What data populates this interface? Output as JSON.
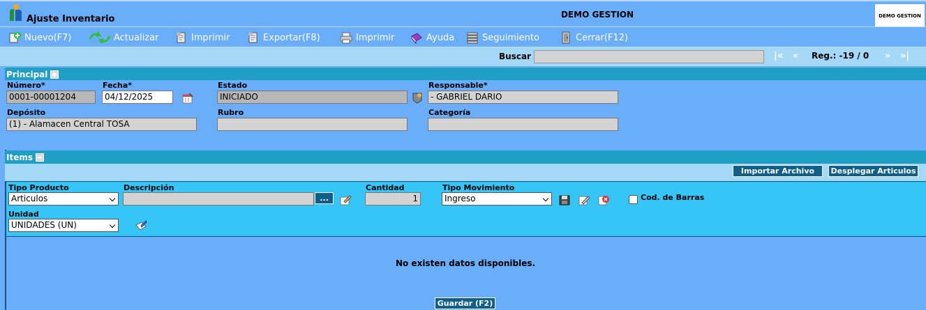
{
  "window": {
    "title": "Ajuste Inventario",
    "company": "DEMO GESTION",
    "logo_text": "DEMO GESTION"
  },
  "toolbar": {
    "nuevo": "Nuevo(F7)",
    "actualizar": "Actualizar",
    "imprimir1": "Imprimir",
    "exportar": "Exportar(F8)",
    "imprimir2": "Imprimir",
    "ayuda": "Ayuda",
    "seguimiento": "Seguimiento",
    "cerrar": "Cerrar(F12)"
  },
  "search": {
    "label": "Buscar",
    "value": "",
    "first": "|«",
    "prev": "«",
    "record": "Reg.: -19 / 0",
    "next": "»",
    "last": "»|"
  },
  "principal": {
    "title": "Principal",
    "numero_label": "Número*",
    "numero_value": "0001-00001204",
    "fecha_label": "Fecha*",
    "fecha_value": "04/12/2025",
    "estado_label": "Estado",
    "estado_value": "INICIADO",
    "responsable_label": "Responsable*",
    "responsable_value": "- GABRIEL DARIO",
    "deposito_label": "Depósito",
    "deposito_value": "(1) - Alamacen Central TOSA",
    "rubro_label": "Rubro",
    "rubro_value": "",
    "categoria_label": "Categoría",
    "categoria_value": ""
  },
  "items": {
    "title": "Items",
    "importar": "Importar Archivo",
    "desplegar": "Desplegar Articulos",
    "tipo_producto_label": "Tipo Producto",
    "tipo_producto_value": "Articulos",
    "descripcion_label": "Descripción",
    "descripcion_value": "",
    "ellipsis": "...",
    "cantidad_label": "Cantidad",
    "cantidad_value": "1",
    "tipo_mov_label": "Tipo Movimiento",
    "tipo_mov_value": "Ingreso",
    "barras_label": "Cod. de Barras",
    "unidad_label": "Unidad",
    "unidad_value": "UNIDADES (UN)",
    "empty": "No existen datos disponibles."
  },
  "footer": {
    "guardar": "Guardar (F2)"
  },
  "colors": {
    "background": "#6aadf8",
    "section_header": "#1f9fc3",
    "light_band": "#a4d8f6",
    "form_band": "#35c6f7",
    "button": "#0f5f8a"
  }
}
